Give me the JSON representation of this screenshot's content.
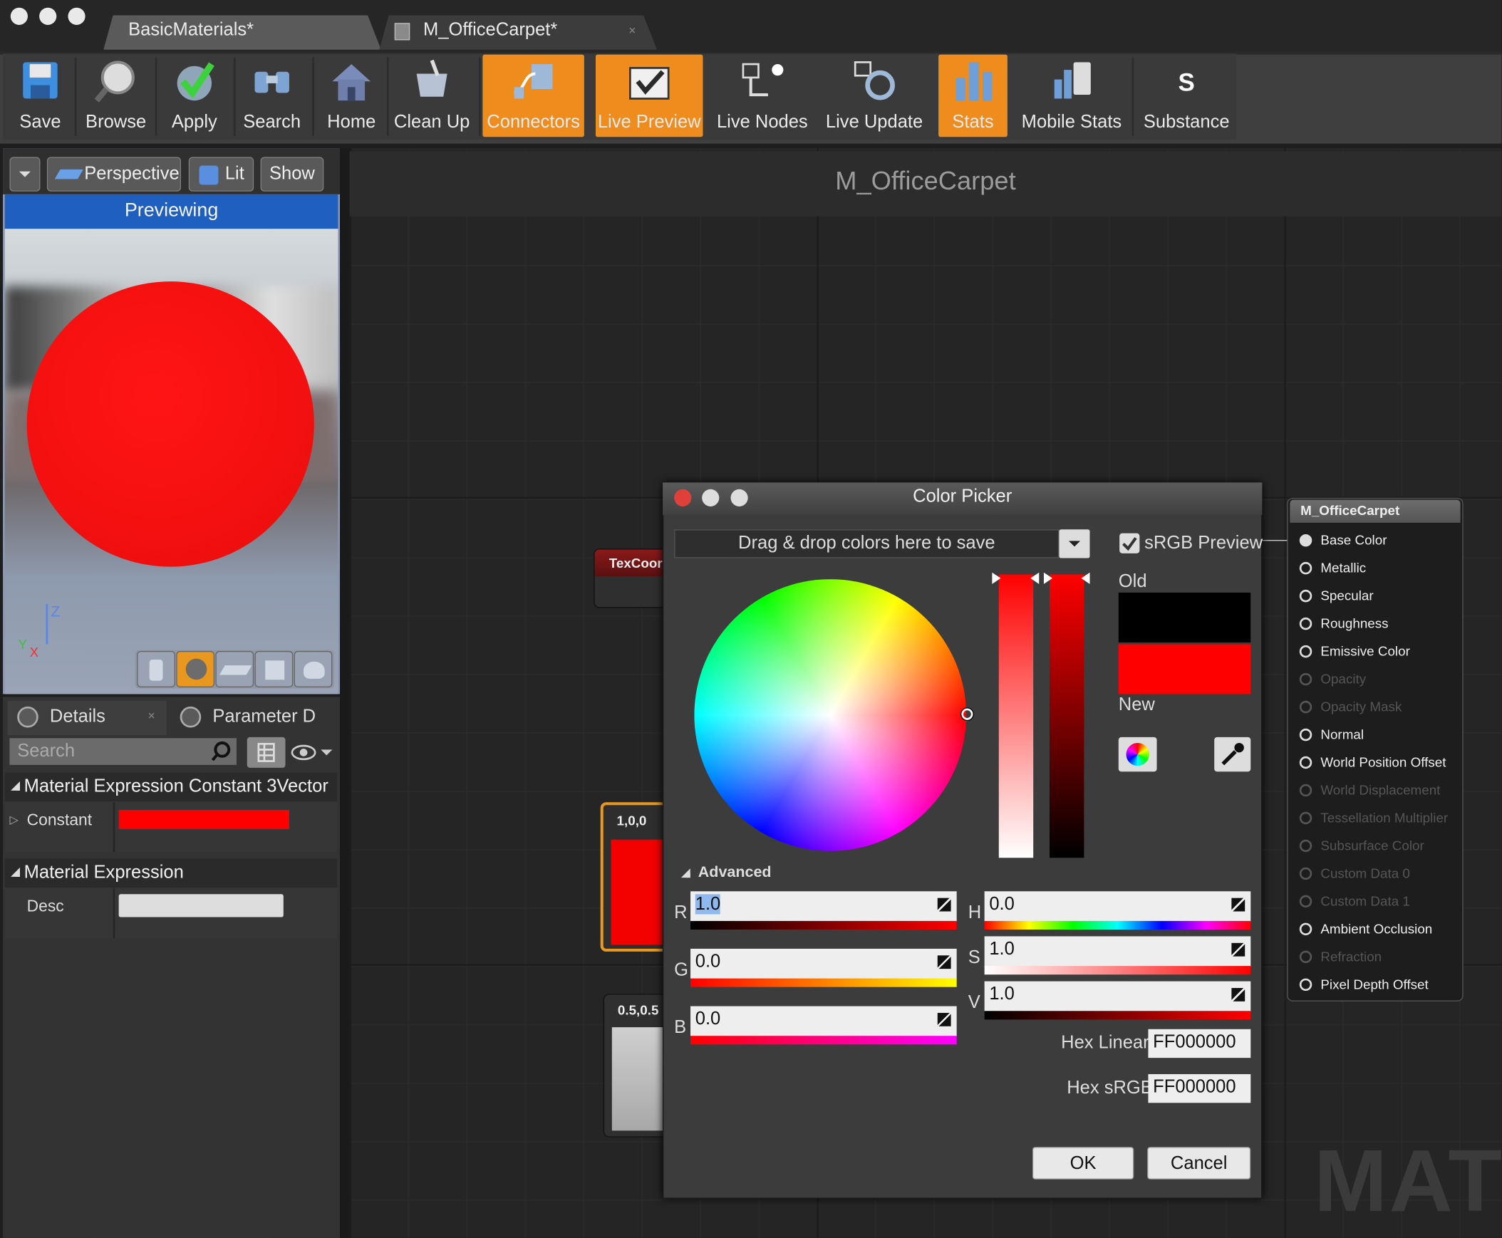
{
  "tabs": [
    {
      "label": "BasicMaterials*"
    },
    {
      "label": "M_OfficeCarpet*"
    }
  ],
  "toolbar": [
    {
      "label": "Save",
      "icon": "save-icon",
      "active": false
    },
    {
      "label": "Browse",
      "icon": "browse-icon",
      "active": false
    },
    {
      "label": "Apply",
      "icon": "apply-icon",
      "active": false
    },
    {
      "label": "Search",
      "icon": "search-icon",
      "active": false
    },
    {
      "label": "Home",
      "icon": "home-icon",
      "active": false
    },
    {
      "label": "Clean Up",
      "icon": "cleanup-icon",
      "active": false
    },
    {
      "label": "Connectors",
      "icon": "connectors-icon",
      "active": true
    },
    {
      "label": "Live Preview",
      "icon": "live-preview-icon",
      "active": true
    },
    {
      "label": "Live Nodes",
      "icon": "live-nodes-icon",
      "active": false
    },
    {
      "label": "Live Update",
      "icon": "live-update-icon",
      "active": false
    },
    {
      "label": "Stats",
      "icon": "stats-icon",
      "active": true
    },
    {
      "label": "Mobile Stats",
      "icon": "mobile-stats-icon",
      "active": false
    },
    {
      "label": "Substance",
      "icon": "substance-icon",
      "active": false
    }
  ],
  "viewport": {
    "perspective": "Perspective",
    "lit": "Lit",
    "show": "Show",
    "previewing": "Previewing",
    "axis_z": "Z",
    "axis_x": "X",
    "axis_y": "Y",
    "sphere_color": "#ff1414"
  },
  "details": {
    "tab_details": "Details",
    "tab_params": "Parameter D",
    "search_placeholder": "Search",
    "cat1": "Material Expression Constant 3Vector",
    "constant_label": "Constant",
    "constant_color": "#ff0000",
    "cat2": "Material Expression",
    "desc_label": "Desc"
  },
  "graph": {
    "title": "M_OfficeCarpet",
    "watermark": "MATE",
    "texcoord": "TexCoor",
    "node_red": "1,0,0",
    "node_gray": "0.5,0.5"
  },
  "material_node": {
    "title": "M_OfficeCarpet",
    "pins": [
      {
        "label": "Base Color",
        "enabled": true,
        "connected": true
      },
      {
        "label": "Metallic",
        "enabled": true,
        "connected": false
      },
      {
        "label": "Specular",
        "enabled": true,
        "connected": false
      },
      {
        "label": "Roughness",
        "enabled": true,
        "connected": false
      },
      {
        "label": "Emissive Color",
        "enabled": true,
        "connected": false
      },
      {
        "label": "Opacity",
        "enabled": false,
        "connected": false
      },
      {
        "label": "Opacity Mask",
        "enabled": false,
        "connected": false
      },
      {
        "label": "Normal",
        "enabled": true,
        "connected": false
      },
      {
        "label": "World Position Offset",
        "enabled": true,
        "connected": false
      },
      {
        "label": "World Displacement",
        "enabled": false,
        "connected": false
      },
      {
        "label": "Tessellation Multiplier",
        "enabled": false,
        "connected": false
      },
      {
        "label": "Subsurface Color",
        "enabled": false,
        "connected": false
      },
      {
        "label": "Custom Data 0",
        "enabled": false,
        "connected": false
      },
      {
        "label": "Custom Data 1",
        "enabled": false,
        "connected": false
      },
      {
        "label": "Ambient Occlusion",
        "enabled": true,
        "connected": false
      },
      {
        "label": "Refraction",
        "enabled": false,
        "connected": false
      },
      {
        "label": "Pixel Depth Offset",
        "enabled": true,
        "connected": false
      }
    ]
  },
  "color_picker": {
    "title": "Color Picker",
    "drop_hint": "Drag & drop colors here to save",
    "srgb_preview": "sRGB Preview",
    "srgb_checked": true,
    "old_label": "Old",
    "new_label": "New",
    "old_color": "#000000",
    "new_color": "#ff0000",
    "advanced": "Advanced",
    "r_label": "R",
    "r_value": "1.0",
    "g_label": "G",
    "g_value": "0.0",
    "b_label": "B",
    "b_value": "0.0",
    "h_label": "H",
    "h_value": "0.0",
    "s_label": "S",
    "s_value": "1.0",
    "v_label": "V",
    "v_value": "1.0",
    "hex_linear_label": "Hex Linear",
    "hex_linear": "FF000000",
    "hex_srgb_label": "Hex sRGB",
    "hex_srgb": "FF000000",
    "ok": "OK",
    "cancel": "Cancel"
  },
  "colors": {
    "accent": "#ee8d1e",
    "selection": "#1f5fc0"
  }
}
